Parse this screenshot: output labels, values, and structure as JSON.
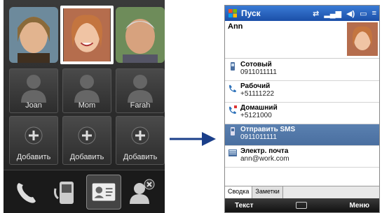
{
  "left_screen": {
    "contacts": [
      {
        "label": "Joan"
      },
      {
        "label": "Mom"
      },
      {
        "label": "Farah"
      }
    ],
    "add_label": "Добавить"
  },
  "right_screen": {
    "title": "Пуск",
    "contact_name": "Ann",
    "rows": [
      {
        "label": "Сотовый",
        "value": "0911011111",
        "icon": "mobile-phone-icon"
      },
      {
        "label": "Рабочий",
        "value": "+51111222",
        "icon": "work-phone-icon"
      },
      {
        "label": "Домашний",
        "value": "+5121000",
        "icon": "home-phone-icon"
      },
      {
        "label": "Отправить SMS",
        "value": "0911011111",
        "icon": "sms-icon",
        "selected": true
      },
      {
        "label": "Электр. почта",
        "value": "ann@work.com",
        "icon": "email-icon"
      }
    ],
    "tabs": [
      "Сводка",
      "Заметки"
    ],
    "softkeys": {
      "left": "Текст",
      "right": "Меню"
    }
  },
  "colors": {
    "accent": "#1b4fa8",
    "selection": "#4a6fa0",
    "arrow": "#1b3f8a"
  }
}
